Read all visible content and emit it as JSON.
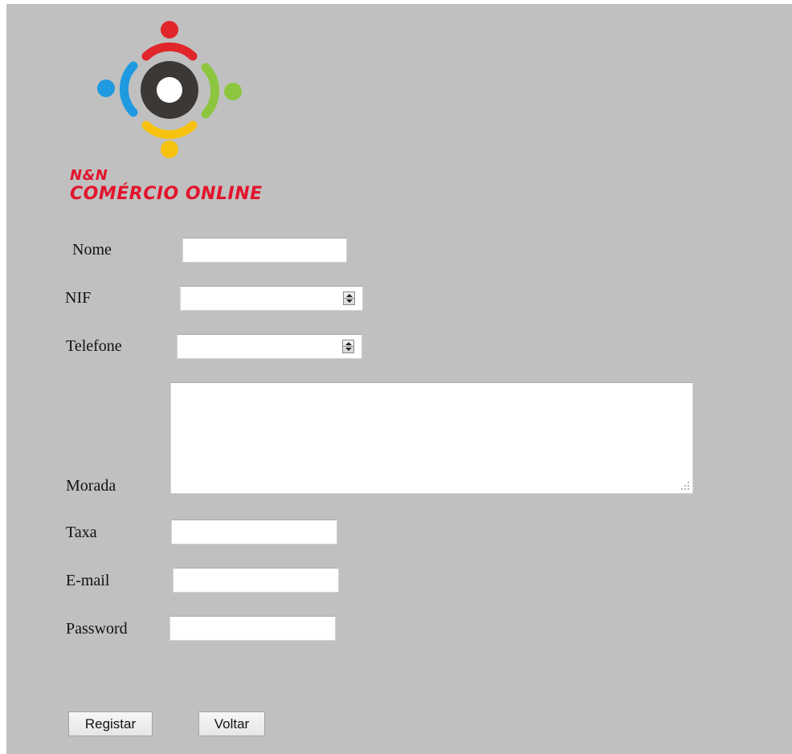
{
  "brand": {
    "line1": "N&N",
    "line2": "COMÉRCIO ONLINE"
  },
  "logo": {
    "icon": "logo-icon",
    "colors": {
      "red": "#e0262b",
      "green": "#8cc63f",
      "blue": "#1f9ae0",
      "yellow": "#f6c20f",
      "ring": "#3c3836"
    }
  },
  "form": {
    "nome": {
      "label": "Nome",
      "value": ""
    },
    "nif": {
      "label": "NIF",
      "value": ""
    },
    "telefone": {
      "label": "Telefone",
      "value": ""
    },
    "morada": {
      "label": "Morada",
      "value": ""
    },
    "taxa": {
      "label": "Taxa",
      "value": ""
    },
    "email": {
      "label": "E-mail",
      "value": ""
    },
    "password": {
      "label": "Password",
      "value": ""
    }
  },
  "buttons": {
    "registar": "Registar",
    "voltar": "Voltar"
  },
  "colors": {
    "page_background": "#c0c0c0",
    "brand_text": "#e2142d"
  }
}
